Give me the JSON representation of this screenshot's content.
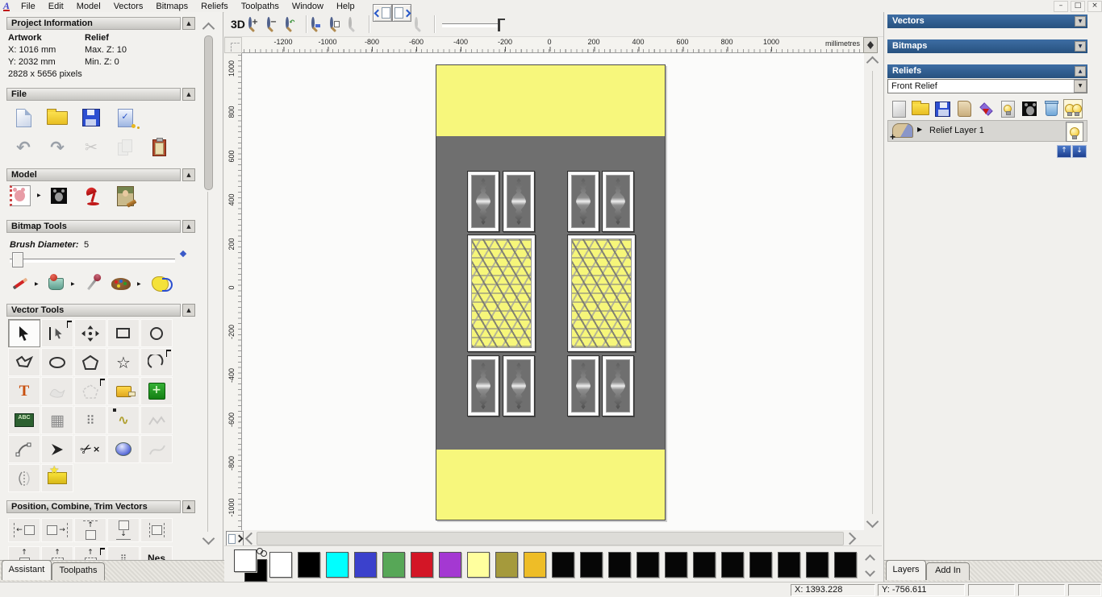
{
  "window_controls": {
    "minimize": "–",
    "restore": "□",
    "close": "×"
  },
  "menu": {
    "logo_text": "A",
    "items": [
      "File",
      "Edit",
      "Model",
      "Vectors",
      "Bitmaps",
      "Reliefs",
      "Toolpaths",
      "Window",
      "Help"
    ]
  },
  "assistant": {
    "tabs": [
      "Assistant",
      "Toolpaths"
    ],
    "project_information": {
      "title": "Project Information",
      "artwork_label": "Artwork",
      "relief_label": "Relief",
      "artwork_x": "X: 1016 mm",
      "artwork_y": "Y: 2032 mm",
      "relief_max_z": "Max. Z: 10",
      "relief_min_z": "Min. Z: 0",
      "pixels": "2828 x 5656 pixels"
    },
    "file_section": {
      "title": "File"
    },
    "model_section": {
      "title": "Model"
    },
    "bitmap_section": {
      "title": "Bitmap Tools",
      "brush_diameter_label": "Brush Diameter:",
      "brush_diameter_value": "5"
    },
    "vector_section": {
      "title": "Vector Tools",
      "text_tool_glyph": "T",
      "abc_glyph": "ABC"
    },
    "position_section": {
      "title": "Position, Combine, Trim Vectors",
      "nesting_label": "Nes"
    }
  },
  "canvas_toolbar": {
    "view_3d_label": "3D"
  },
  "ruler": {
    "units": "millimetres",
    "horizontal": [
      "-1200",
      "-1000",
      "-800",
      "-600",
      "-400",
      "-200",
      "0",
      "200",
      "400",
      "600",
      "800",
      "1000"
    ],
    "vertical": [
      "1000",
      "800",
      "600",
      "400",
      "200",
      "0",
      "-200",
      "-400",
      "-600",
      "-800",
      "-1000"
    ]
  },
  "design": {
    "yellow": "#f7f77c",
    "gray": "#6f6f6f"
  },
  "right_panel": {
    "vectors_title": "Vectors",
    "bitmaps_title": "Bitmaps",
    "reliefs_title": "Reliefs",
    "relief_selector_value": "Front Relief",
    "layer_name": "Relief Layer 1",
    "tabs": [
      "Layers",
      "Add In"
    ]
  },
  "palette": {
    "primary": "#ffffff",
    "secondary": "#000000",
    "colors": [
      "#ffffff",
      "#000000",
      "#00ffff",
      "#3b41cc",
      "#57a757",
      "#d31626",
      "#a438d2",
      "#ffff9e",
      "#a59a3c",
      "#eebd27",
      "#060606",
      "#060606",
      "#060606",
      "#060606",
      "#060606",
      "#060606",
      "#060606",
      "#060606",
      "#060606",
      "#060606",
      "#060606"
    ]
  },
  "status_bar": {
    "x": "X: 1393.228",
    "y": "Y: -756.611"
  },
  "glyphs": {
    "collapse": "▲",
    "expand": "▼",
    "flyout": "▶",
    "undo": "↶",
    "redo": "↷",
    "cut": "✂",
    "scissors": "✂",
    "star_outline": "☆",
    "star_solid": "★",
    "wave": "∿",
    "grid": "▦",
    "scatter": "⠿",
    "plus": "+",
    "minus": "−",
    "up": "↑",
    "down": "↓",
    "left": "←",
    "right": "→",
    "both": "↔",
    "check": "✓",
    "dropdown": "▼",
    "cross": "×"
  }
}
